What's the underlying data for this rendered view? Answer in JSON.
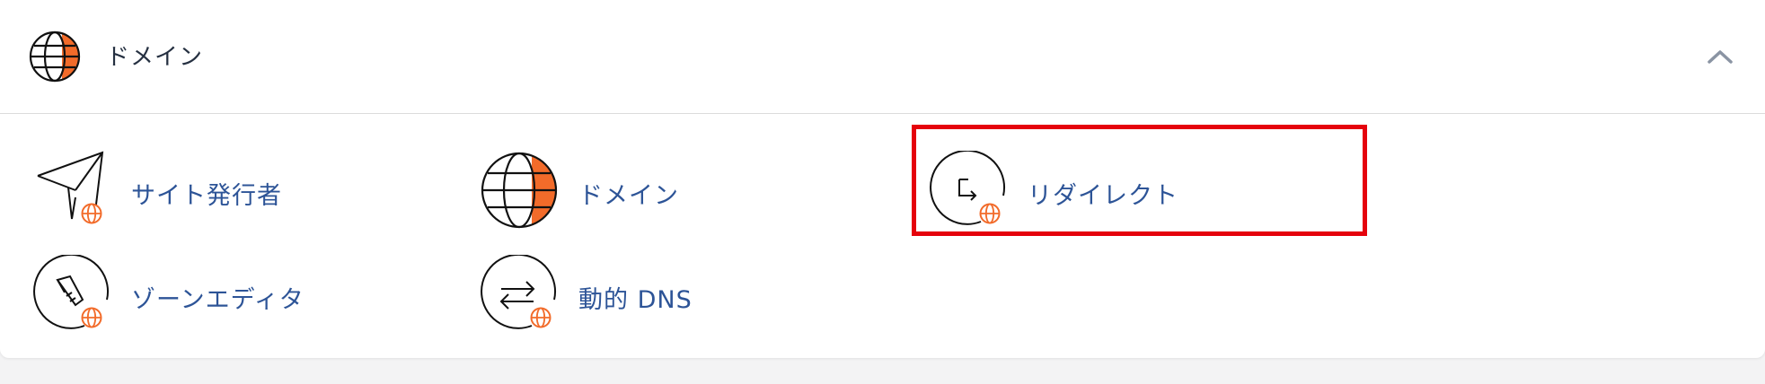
{
  "section": {
    "title": "ドメイン",
    "icon": "globe-icon",
    "collapse_icon": "chevron-up-icon"
  },
  "items": [
    {
      "label": "サイト発行者",
      "icon": "site-publisher-icon"
    },
    {
      "label": "ドメイン",
      "icon": "domains-globe-icon"
    },
    {
      "label": "リダイレクト",
      "icon": "redirects-icon"
    },
    {
      "label": "ゾーンエディタ",
      "icon": "zone-editor-icon"
    },
    {
      "label": "動的 DNS",
      "icon": "dynamic-dns-icon"
    }
  ],
  "colors": {
    "accent_orange": "#f26b2a",
    "link_blue": "#2d5497",
    "highlight_red": "#e5020c"
  }
}
